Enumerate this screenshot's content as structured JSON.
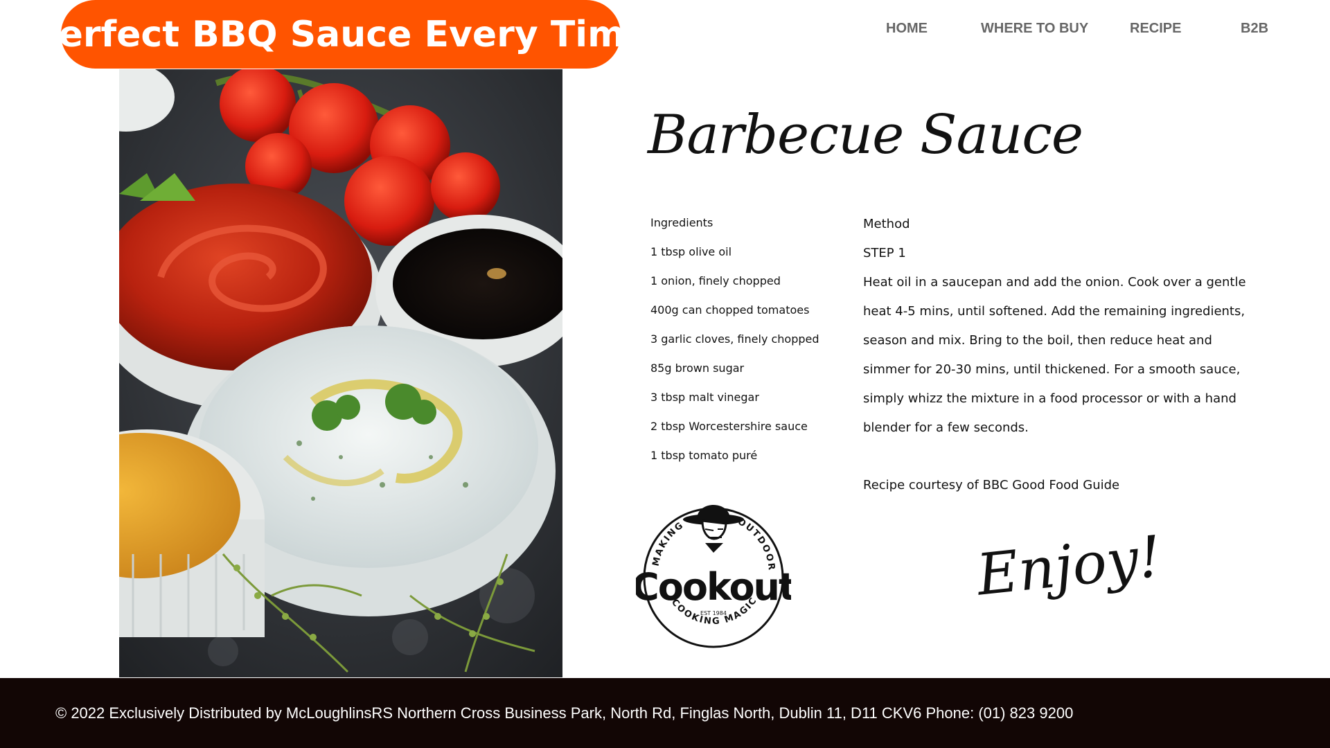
{
  "header": {
    "title": "Perfect BBQ Sauce Every Time"
  },
  "nav": {
    "items": [
      "HOME",
      "WHERE TO BUY",
      "RECIPE",
      "B2B"
    ]
  },
  "recipe": {
    "heading": "Barbecue Sauce",
    "ingredients_label": "Ingredients",
    "ingredients": [
      "1 tbsp olive oil",
      "1 onion, finely chopped",
      "400g can chopped tomatoes",
      "3 garlic cloves, finely chopped",
      "85g brown sugar",
      "3 tbsp malt vinegar",
      "2 tbsp Worcestershire sauce",
      "1 tbsp tomato puré"
    ],
    "method_label": "Method",
    "step_label": "STEP 1",
    "method_lines": [
      "Heat oil in a saucepan and add the onion. Cook over a gentle",
      "heat 4-5 mins, until softened. Add the remaining ingredients,",
      "season and mix. Bring to the boil, then reduce heat and",
      "simmer for 20-30 mins, until thickened. For a smooth sauce,",
      "simply whizz the mixture in a food processor or with a hand",
      "blender for a few seconds."
    ],
    "courtesy": "Recipe courtesy of BBC Good Food Guide",
    "signoff": "Enjoy!"
  },
  "logo": {
    "name": "Cookout",
    "arc_left": "MAKING",
    "arc_right": "OUTDOOR",
    "arc_bottom": "COOKING MAGIC",
    "est": "EST 1984"
  },
  "footer": {
    "text": "© 2022 Exclusively Distributed by McLoughlinsRS Northern Cross Business Park, North Rd, Finglas North, Dublin 11, D11 CKV6   Phone: (01) 823 9200"
  },
  "colors": {
    "accent": "#ff5400",
    "footer_bg": "#120605",
    "nav_text": "#666666"
  }
}
